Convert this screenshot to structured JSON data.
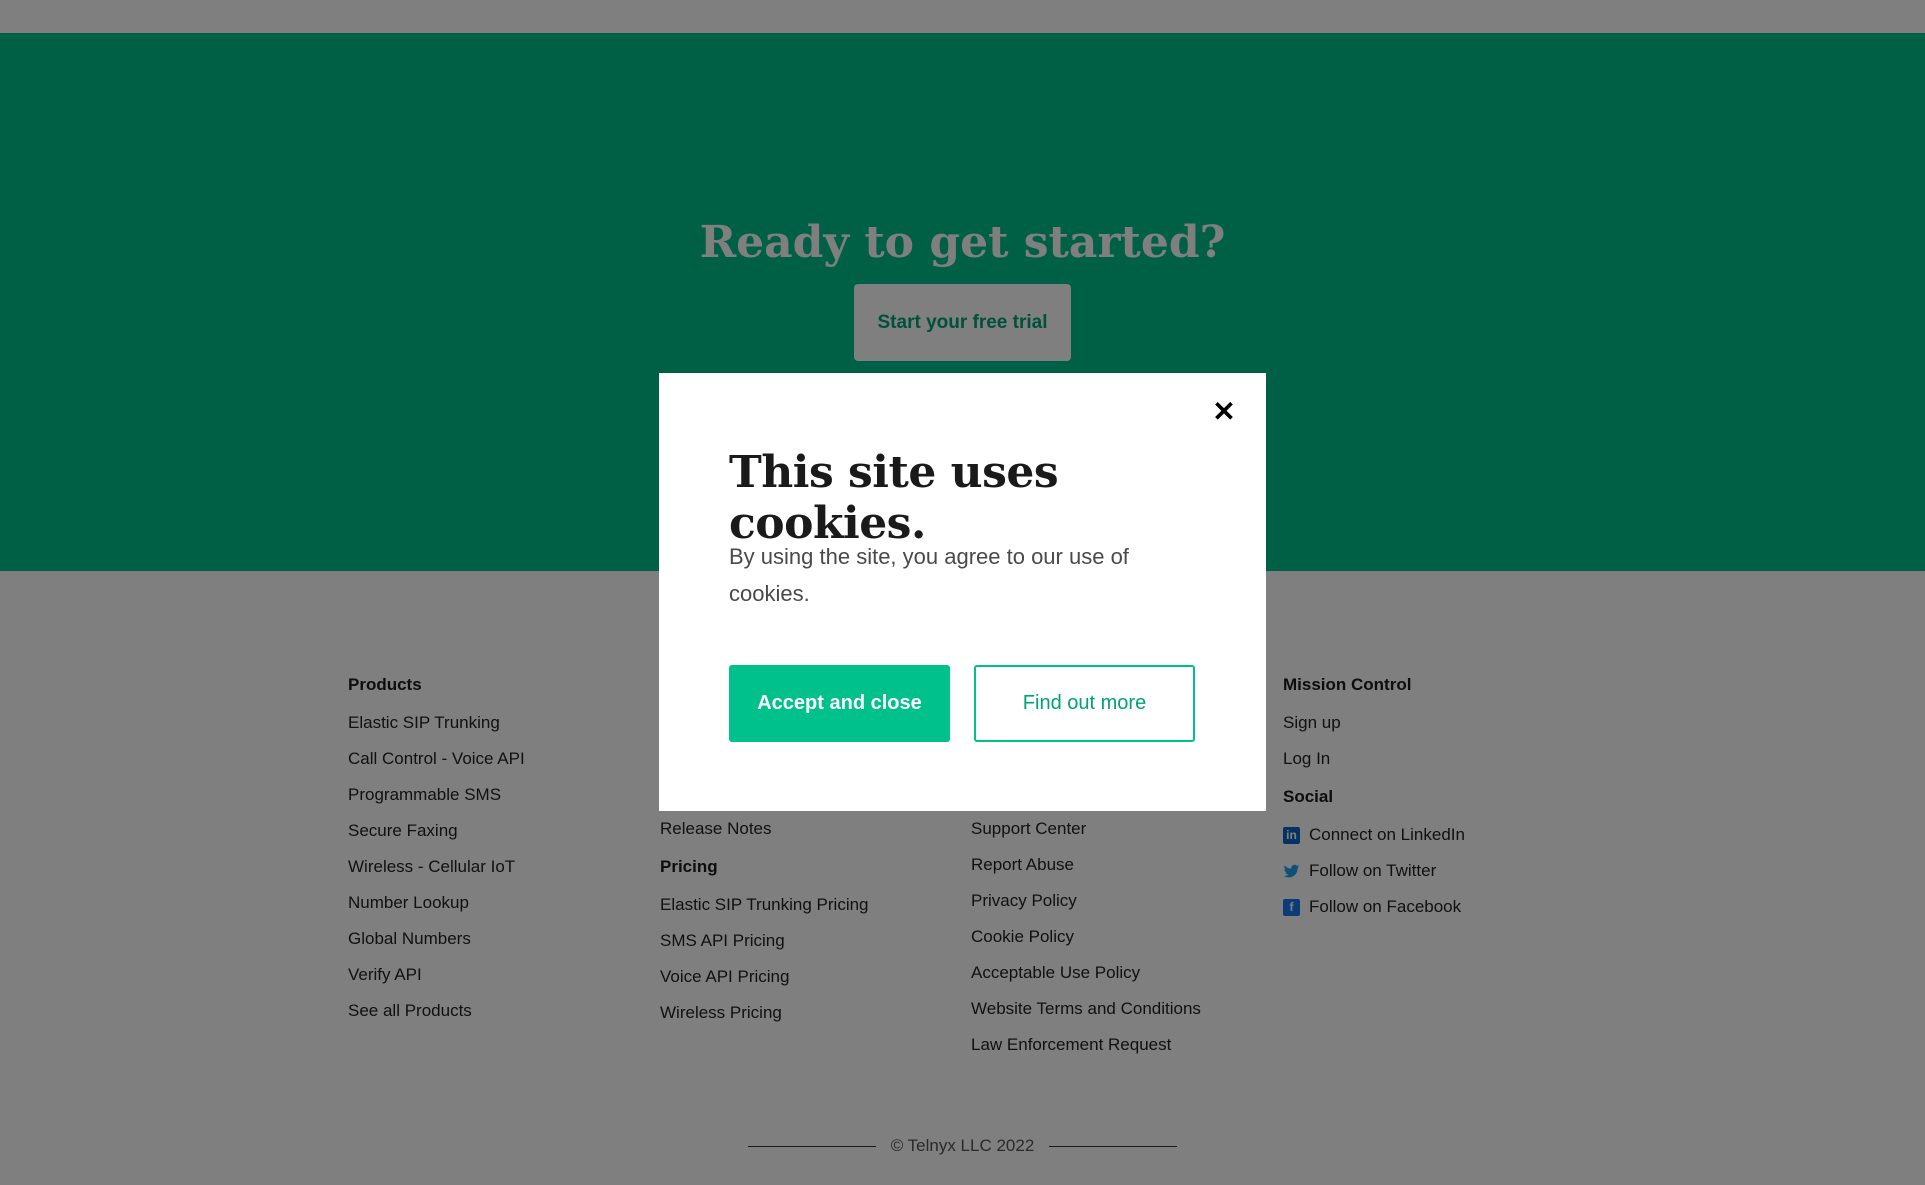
{
  "cta": {
    "title": "Ready to get started?",
    "button_label": "Start your free trial"
  },
  "footer": {
    "columns": [
      {
        "heading": "Products",
        "links": [
          "Elastic SIP Trunking",
          "Call Control - Voice API",
          "Programmable SMS",
          "Secure Faxing",
          "Wireless - Cellular IoT",
          "Number Lookup",
          "Global Numbers",
          "Verify API",
          "See all Products"
        ]
      },
      {
        "links_top": [
          "Release Notes"
        ],
        "subheading": "Pricing",
        "links": [
          "Elastic SIP Trunking Pricing",
          "SMS API Pricing",
          "Voice API Pricing",
          "Wireless Pricing"
        ]
      },
      {
        "links": [
          "Support Center",
          "Report Abuse",
          "Privacy Policy",
          "Cookie Policy",
          "Acceptable Use Policy",
          "Website Terms and Conditions",
          "Law Enforcement Request"
        ]
      },
      {
        "heading": "Mission Control",
        "links": [
          "Sign up",
          "Log In"
        ],
        "subheading": "Social",
        "social": [
          {
            "label": "Connect on LinkedIn",
            "icon": "linkedin-icon"
          },
          {
            "label": "Follow on Twitter",
            "icon": "twitter-icon"
          },
          {
            "label": "Follow on Facebook",
            "icon": "facebook-icon"
          }
        ]
      }
    ],
    "copyright": "© Telnyx LLC 2022"
  },
  "cookie_modal": {
    "title": "This site uses cookies.",
    "text": "By using the site, you agree to our use of cookies.",
    "accept_label": "Accept and close",
    "more_label": "Find out more",
    "close_icon": "close-icon"
  },
  "colors": {
    "brand_green": "#00c08b",
    "overlay": "rgba(0,0,0,0.5)"
  }
}
